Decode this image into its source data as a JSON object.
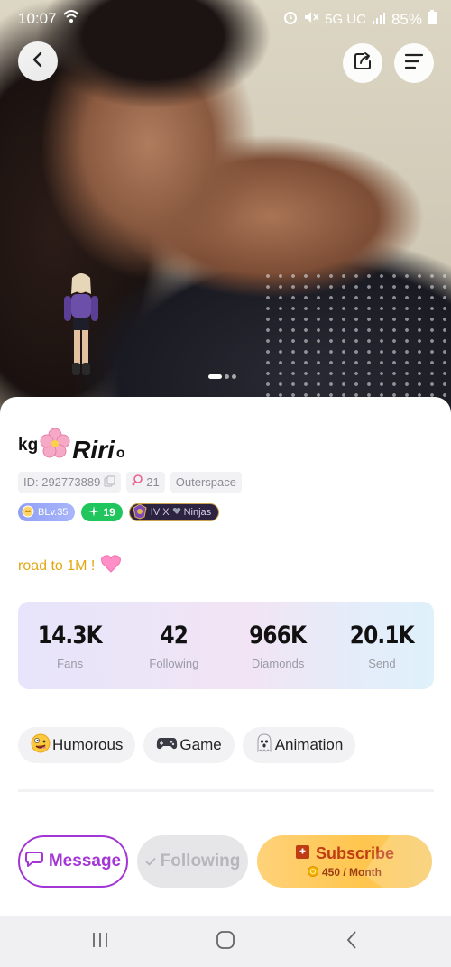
{
  "status_bar": {
    "time": "10:07",
    "network": "5G UC",
    "battery": "85%"
  },
  "profile": {
    "name_prefix": "kg",
    "name_main": "Riri",
    "name_suffix": "o",
    "id_label": "ID: 292773889",
    "fan_count_chip": "21",
    "location": "Outerspace",
    "level_badge": "BLv.35",
    "vip_badge": "19",
    "family_badge": "IV X",
    "family_badge_suffix": "Ninjas",
    "bio": "road to 1M !"
  },
  "stats": [
    {
      "value": "14.3K",
      "label": "Fans"
    },
    {
      "value": "42",
      "label": "Following"
    },
    {
      "value": "966K",
      "label": "Diamonds"
    },
    {
      "value": "20.1K",
      "label": "Send"
    }
  ],
  "tags": [
    {
      "label": "Humorous",
      "icon": "zany-face-emoji"
    },
    {
      "label": "Game",
      "icon": "gamepad-emoji"
    },
    {
      "label": "Animation",
      "icon": "ghost-emoji"
    }
  ],
  "actions": {
    "message": "Message",
    "following": "Following",
    "subscribe": "Subscribe",
    "subscribe_price": "450 / Month"
  },
  "colors": {
    "accent_purple": "#a436d6",
    "bio_yellow": "#e3a712",
    "subscribe_red": "#c03c14",
    "vip_green": "#21c55d"
  },
  "carousel": {
    "pages": 3,
    "active_index": 0
  }
}
